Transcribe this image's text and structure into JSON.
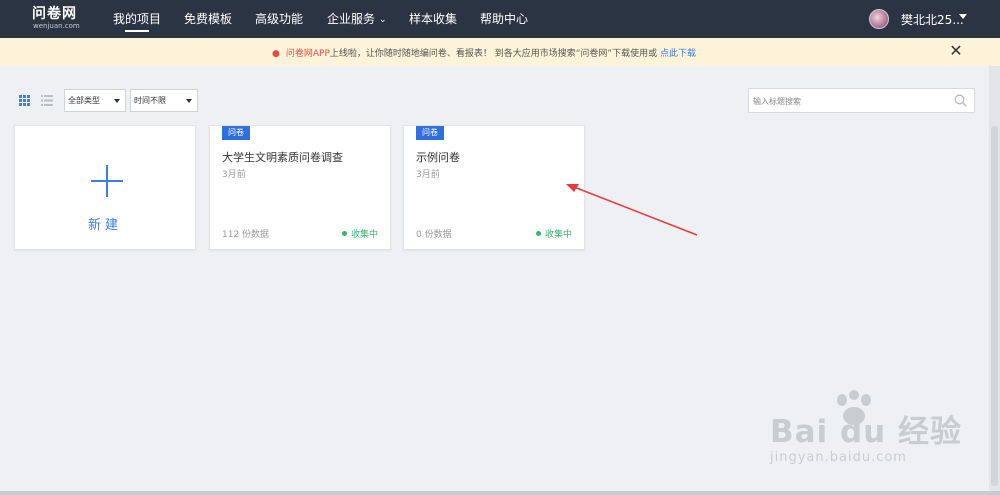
{
  "header": {
    "logo": "问卷网",
    "logo_sub": "wenjuan.com",
    "nav": [
      {
        "label": "我的项目",
        "active": true
      },
      {
        "label": "免费模板"
      },
      {
        "label": "高级功能"
      },
      {
        "label": "企业服务"
      },
      {
        "label": "样本收集"
      },
      {
        "label": "帮助中心"
      }
    ],
    "username": "樊北北25..."
  },
  "notice": {
    "brand": "问卷网APP",
    "text": "上线啦，让你随时随地编问卷、看报表！ 到各大应用市场搜索“问卷网”下载使用或 ",
    "link": "点此下载"
  },
  "toolbar": {
    "type_filter": "全部类型",
    "time_filter": "时间不限",
    "search_placeholder": "输入标题搜索"
  },
  "new_card": {
    "label": "新建"
  },
  "projects": [
    {
      "badge": "问卷",
      "title": "大学生文明素质问卷调查",
      "time": "3月前",
      "count": "112 份数据",
      "status": "收集中"
    },
    {
      "badge": "问卷",
      "title": "示例问卷",
      "time": "3月前",
      "count": "0 份数据",
      "status": "收集中"
    }
  ],
  "watermark": {
    "main": "Bai du 经验",
    "sub": "jingyan.baidu.com"
  },
  "colors": {
    "nav_bg": "#2b3443",
    "accent": "#3c7de6",
    "badge": "#2f6fde",
    "status": "#3ab36d",
    "annotation": "#e83a3a"
  }
}
